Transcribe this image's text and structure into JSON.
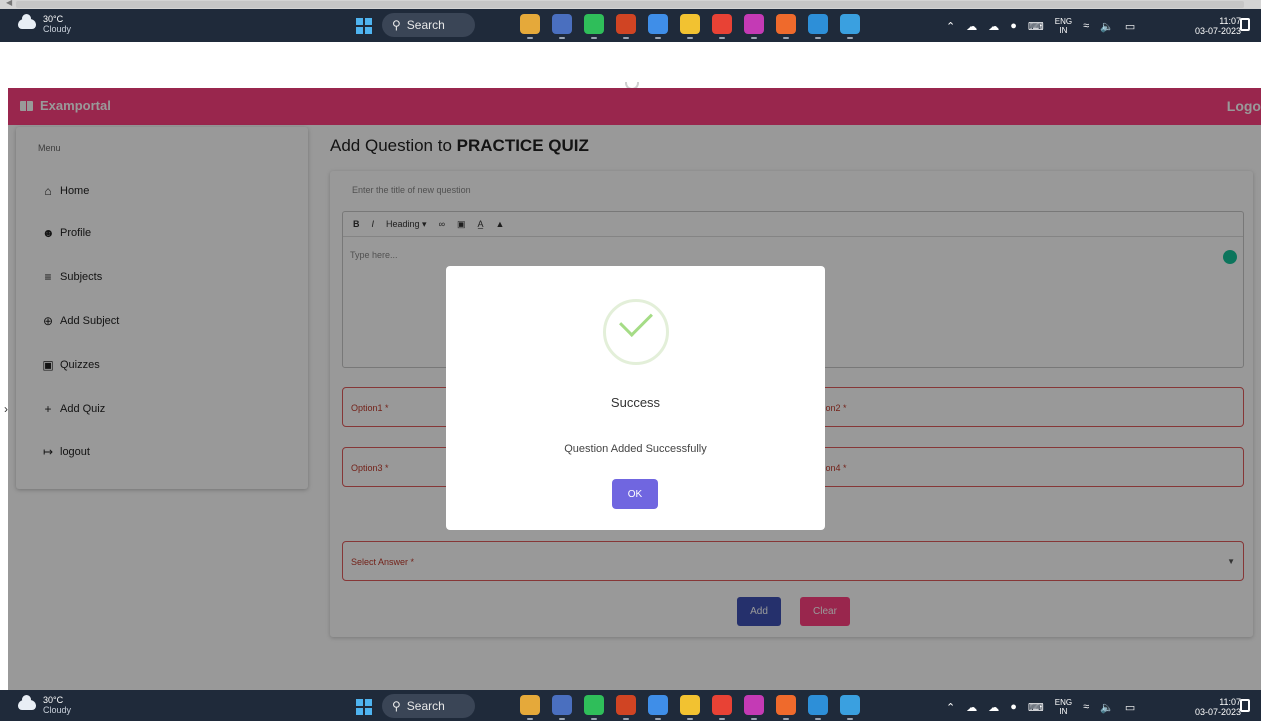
{
  "taskbar": {
    "weather_temp": "30°C",
    "weather_cond": "Cloudy",
    "search_label": "Search",
    "lang_top": "ENG",
    "lang_bottom": "IN",
    "time": "11:07",
    "date": "03-07-2023",
    "apps": [
      {
        "name": "app-tray-icon",
        "color": "#e5a93a"
      },
      {
        "name": "notes-icon",
        "color": "#4a6fbf"
      },
      {
        "name": "whatsapp-icon",
        "color": "#2fbe5a"
      },
      {
        "name": "powerpoint-icon",
        "color": "#d04423"
      },
      {
        "name": "notepad-icon",
        "color": "#3f8ee8"
      },
      {
        "name": "file-explorer-icon",
        "color": "#f2c231"
      },
      {
        "name": "chrome-icon",
        "color": "#e84235"
      },
      {
        "name": "intellij-icon",
        "color": "#c43ab5"
      },
      {
        "name": "xampp-icon",
        "color": "#ef6a2c"
      },
      {
        "name": "vscode-icon",
        "color": "#2d8fd8"
      },
      {
        "name": "photos-icon",
        "color": "#3aa0e0"
      }
    ]
  },
  "appbar": {
    "brand": "Examportal",
    "logo": "Logo",
    "color": "#ff4081"
  },
  "sidebar": {
    "title": "Menu",
    "items": [
      {
        "label": "Home",
        "icon": "home-icon"
      },
      {
        "label": "Profile",
        "icon": "profile-icon"
      },
      {
        "label": "Subjects",
        "icon": "list-icon"
      },
      {
        "label": "Add Subject",
        "icon": "add-circle-icon"
      },
      {
        "label": "Quizzes",
        "icon": "quiz-icon"
      },
      {
        "label": "Add Quiz",
        "icon": "plus-icon"
      },
      {
        "label": "logout",
        "icon": "logout-icon"
      }
    ]
  },
  "main": {
    "title_prefix": "Add Question to",
    "title_quiz": "PRACTICE QUIZ",
    "question_placeholder": "Enter the title of new question",
    "editor": {
      "bold": "B",
      "italic": "I",
      "heading": "Heading",
      "placeholder": "Type here..."
    },
    "option1": "Option1 *",
    "option2": "Option2 *",
    "option3": "Option3 *",
    "option4": "Option4 *",
    "select_answer": "Select Answer *",
    "add_label": "Add",
    "clear_label": "Clear"
  },
  "modal": {
    "title": "Success",
    "message": "Question Added Successfully",
    "ok_label": "OK"
  }
}
